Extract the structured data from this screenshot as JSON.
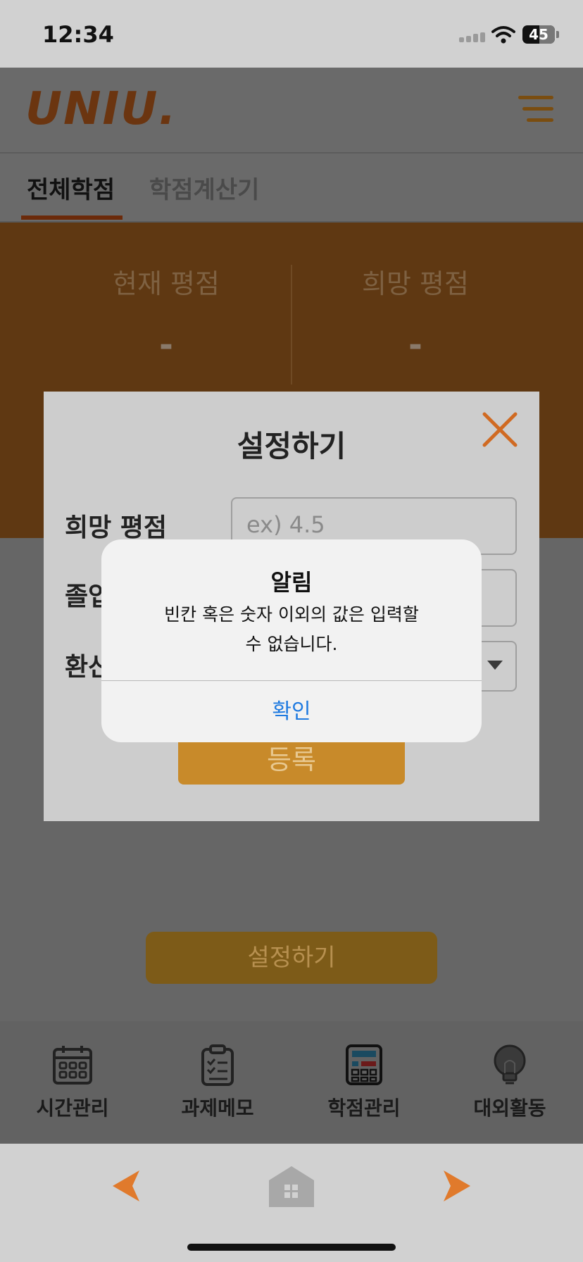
{
  "status_bar": {
    "time": "12:34",
    "battery": "45"
  },
  "header": {
    "logo": "UNIU."
  },
  "tabs": [
    {
      "label": "전체학점"
    },
    {
      "label": "학점계산기"
    }
  ],
  "gpa": {
    "current_label": "현재 평점",
    "current_value": "-",
    "target_label": "희망 평점",
    "target_value": "-"
  },
  "modal": {
    "title": "설정하기",
    "fields": [
      {
        "label": "희망 평점",
        "placeholder": "ex) 4.5"
      },
      {
        "label": "졸업"
      },
      {
        "label": "환산"
      }
    ],
    "register_label": "등록"
  },
  "set_button_label": "설정하기",
  "bottom_nav": [
    {
      "label": "시간관리",
      "icon": "calendar-icon"
    },
    {
      "label": "과제메모",
      "icon": "clipboard-icon"
    },
    {
      "label": "학점관리",
      "icon": "calculator-icon"
    },
    {
      "label": "대외활동",
      "icon": "lightbulb-icon"
    }
  ],
  "alert": {
    "title": "알림",
    "message_line1": "빈칸 혹은 숫자 이외의 값은 입력할",
    "message_line2": "수 없습니다.",
    "ok_label": "확인"
  },
  "colors": {
    "accent_orange": "#e07a2c",
    "ios_blue": "#1f7ae0"
  }
}
